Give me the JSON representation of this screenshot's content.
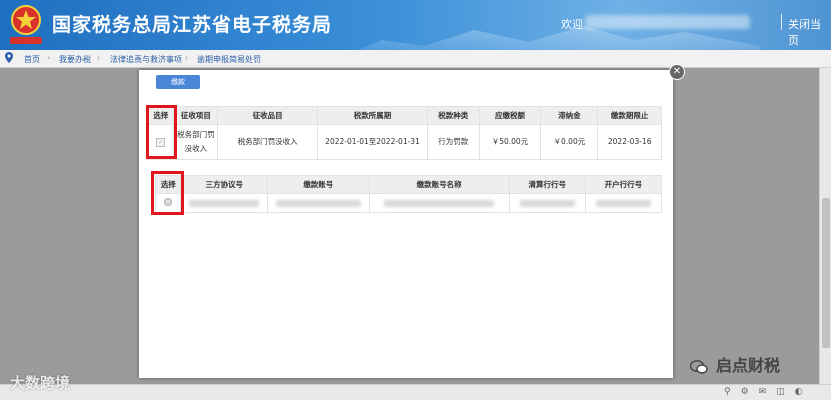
{
  "header": {
    "title": "国家税务总局江苏省电子税务局",
    "welcome": "欢迎",
    "close_page": "关闭当页"
  },
  "breadcrumb": [
    "首页",
    "我要办税",
    "法律追责与救济事项",
    "逾期申报简易处罚"
  ],
  "modal": {
    "pay_button": "缴款",
    "tax_table": {
      "headers": [
        "选择",
        "征收项目",
        "征收品目",
        "税款所属期",
        "税款种类",
        "应缴税额",
        "滞纳金",
        "缴款期限止"
      ],
      "rows": [
        {
          "item": "税务部门罚没收入",
          "subitem": "税务部门罚没收入",
          "period": "2022-01-01至2022-01-31",
          "kind": "行为罚款",
          "amount": "￥50.00元",
          "late_fee": "￥0.00元",
          "deadline": "2022-03-16"
        }
      ]
    },
    "account_table": {
      "headers": [
        "选择",
        "三方协议号",
        "缴款账号",
        "缴款账号名称",
        "清算行行号",
        "开户行行号"
      ]
    }
  },
  "watermarks": {
    "left": "大数跨境",
    "right": "启点财税"
  },
  "colors": {
    "header_blue": "#2f7fcd",
    "highlight_red": "#e0161e",
    "button_blue": "#4a86d8"
  }
}
